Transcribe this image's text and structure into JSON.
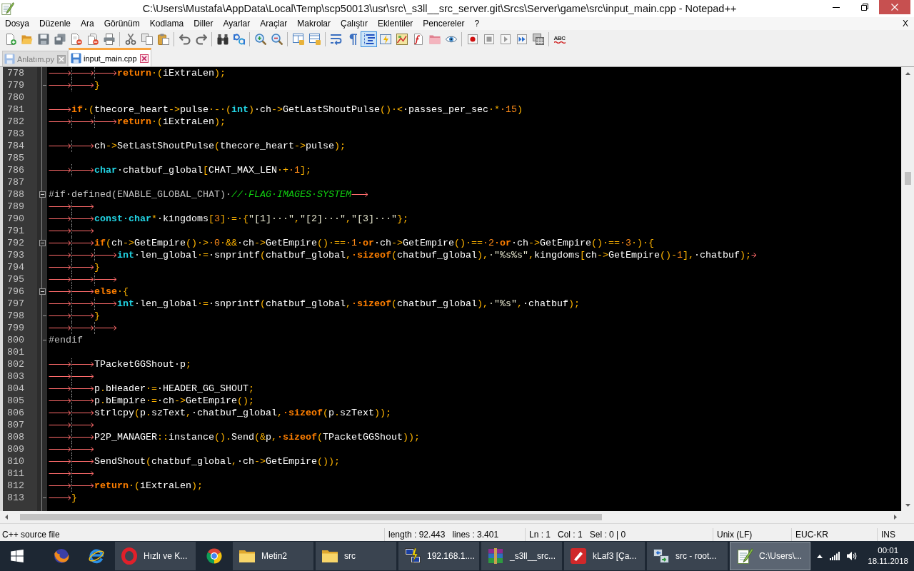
{
  "window": {
    "title": "C:\\Users\\Mustafa\\AppData\\Local\\Temp\\scp50013\\usr\\src\\_s3ll__src_server.git\\Srcs\\Server\\game\\src\\input_main.cpp - Notepad++"
  },
  "menu": {
    "items": [
      "Dosya",
      "Düzenle",
      "Ara",
      "Görünüm",
      "Kodlama",
      "Diller",
      "Ayarlar",
      "Araçlar",
      "Makrolar",
      "Çalıştır",
      "Eklentiler",
      "Pencereler",
      "?"
    ],
    "close": "X"
  },
  "toolbar": {
    "groups": [
      {
        "buttons": [
          {
            "kind": "new",
            "on": false
          },
          {
            "kind": "open",
            "on": false
          },
          {
            "kind": "save",
            "on": false
          },
          {
            "kind": "saveall",
            "on": false
          },
          {
            "kind": "close",
            "on": false
          },
          {
            "kind": "closeall",
            "on": false
          },
          {
            "kind": "print",
            "on": false
          }
        ]
      },
      {
        "buttons": [
          {
            "kind": "cut",
            "on": false
          },
          {
            "kind": "copy",
            "on": false
          },
          {
            "kind": "paste",
            "on": false
          }
        ]
      },
      {
        "buttons": [
          {
            "kind": "undo",
            "on": false
          },
          {
            "kind": "redo",
            "on": false
          }
        ]
      },
      {
        "buttons": [
          {
            "kind": "find",
            "on": false
          },
          {
            "kind": "replace",
            "on": false
          }
        ]
      },
      {
        "buttons": [
          {
            "kind": "zoomin",
            "on": false
          },
          {
            "kind": "zoomout",
            "on": false
          }
        ]
      },
      {
        "buttons": [
          {
            "kind": "syncv",
            "on": false
          },
          {
            "kind": "synch",
            "on": false
          }
        ]
      },
      {
        "buttons": [
          {
            "kind": "wrap",
            "on": false
          },
          {
            "kind": "allchars",
            "on": false
          },
          {
            "kind": "guide",
            "on": true
          },
          {
            "kind": "udl",
            "on": false
          },
          {
            "kind": "docmap",
            "on": false
          },
          {
            "kind": "funclist",
            "on": false
          },
          {
            "kind": "workspace",
            "on": false
          },
          {
            "kind": "monitor",
            "on": false
          }
        ]
      },
      {
        "buttons": [
          {
            "kind": "record",
            "on": false
          },
          {
            "kind": "stop",
            "on": false
          },
          {
            "kind": "play",
            "on": false
          },
          {
            "kind": "playmulti",
            "on": false
          },
          {
            "kind": "savemacro",
            "on": false
          }
        ]
      },
      {
        "buttons": [
          {
            "kind": "spell",
            "text": "ABC"
          }
        ]
      }
    ]
  },
  "tabs": [
    {
      "label": "Anlatım.py",
      "selected": false
    },
    {
      "label": "input_main.cpp",
      "selected": true
    }
  ],
  "editor": {
    "lines": [
      {
        "number": "778",
        "kind": "plain",
        "tokens": [
          {
            "kind": "tab"
          },
          {
            "kind": "tab"
          },
          {
            "kind": "tab"
          },
          {
            "kind": "kw",
            "text": "return"
          },
          {
            "kind": "op",
            "text": "·("
          },
          {
            "kind": "id",
            "text": "iExtraLen"
          },
          {
            "kind": "op",
            "text": ");"
          }
        ]
      },
      {
        "number": "779",
        "kind": "foldtail",
        "tokens": [
          {
            "kind": "tab"
          },
          {
            "kind": "tab"
          },
          {
            "kind": "op",
            "text": "}"
          }
        ]
      },
      {
        "number": "780",
        "kind": "plain"
      },
      {
        "number": "781",
        "kind": "plain",
        "tokens": [
          {
            "kind": "tab"
          },
          {
            "kind": "kw",
            "text": "if"
          },
          {
            "kind": "op",
            "text": "·("
          },
          {
            "kind": "id",
            "text": "thecore_heart"
          },
          {
            "kind": "op",
            "text": "->"
          },
          {
            "kind": "id",
            "text": "pulse"
          },
          {
            "kind": "op",
            "text": "·-·("
          },
          {
            "kind": "type",
            "text": "int"
          },
          {
            "kind": "op",
            "text": ")"
          },
          {
            "kind": "id",
            "text": "·ch"
          },
          {
            "kind": "op",
            "text": "->"
          },
          {
            "kind": "id",
            "text": "GetLastShoutPulse"
          },
          {
            "kind": "op",
            "text": "()·<"
          },
          {
            "kind": "id",
            "text": "·passes_per_sec"
          },
          {
            "kind": "op",
            "text": "·*"
          },
          {
            "kind": "num",
            "text": "·15"
          },
          {
            "kind": "op",
            "text": ")"
          }
        ]
      },
      {
        "number": "782",
        "kind": "plain",
        "tokens": [
          {
            "kind": "tab"
          },
          {
            "kind": "tab"
          },
          {
            "kind": "tab"
          },
          {
            "kind": "kw",
            "text": "return"
          },
          {
            "kind": "op",
            "text": "·("
          },
          {
            "kind": "id",
            "text": "iExtraLen"
          },
          {
            "kind": "op",
            "text": ");"
          }
        ]
      },
      {
        "number": "783",
        "kind": "plain"
      },
      {
        "number": "784",
        "kind": "plain",
        "tokens": [
          {
            "kind": "tab"
          },
          {
            "kind": "tab"
          },
          {
            "kind": "id",
            "text": "ch"
          },
          {
            "kind": "op",
            "text": "->"
          },
          {
            "kind": "id",
            "text": "SetLastShoutPulse"
          },
          {
            "kind": "op",
            "text": "("
          },
          {
            "kind": "id",
            "text": "thecore_heart"
          },
          {
            "kind": "op",
            "text": "->"
          },
          {
            "kind": "id",
            "text": "pulse"
          },
          {
            "kind": "op",
            "text": ");"
          }
        ]
      },
      {
        "number": "785",
        "kind": "plain"
      },
      {
        "number": "786",
        "kind": "plain",
        "tokens": [
          {
            "kind": "tab"
          },
          {
            "kind": "tab"
          },
          {
            "kind": "type",
            "text": "char"
          },
          {
            "kind": "id",
            "text": "·chatbuf_global"
          },
          {
            "kind": "op",
            "text": "["
          },
          {
            "kind": "id",
            "text": "CHAT_MAX_LEN"
          },
          {
            "kind": "op",
            "text": "·+"
          },
          {
            "kind": "num",
            "text": "·1"
          },
          {
            "kind": "op",
            "text": "];"
          }
        ]
      },
      {
        "number": "787",
        "kind": "plain"
      },
      {
        "number": "788",
        "kind": "foldhead",
        "tokens": [
          {
            "kind": "pre",
            "text": "#if·defined(ENABLE_GLOBAL_CHAT)·"
          },
          {
            "kind": "cmt",
            "text": "//·FLAG·IMAGES·SYSTEM"
          },
          {
            "kind": "tab"
          }
        ]
      },
      {
        "number": "789",
        "kind": "plain",
        "tokens": [
          {
            "kind": "tab"
          },
          {
            "kind": "tab"
          }
        ]
      },
      {
        "number": "790",
        "kind": "plain",
        "tokens": [
          {
            "kind": "tab"
          },
          {
            "kind": "tab"
          },
          {
            "kind": "type",
            "text": "const·char"
          },
          {
            "kind": "op",
            "text": "*"
          },
          {
            "kind": "id",
            "text": "·kingdoms"
          },
          {
            "kind": "op",
            "text": "["
          },
          {
            "kind": "num",
            "text": "3"
          },
          {
            "kind": "op",
            "text": "]·=·{"
          },
          {
            "kind": "str",
            "text": "\"[1]···\""
          },
          {
            "kind": "op",
            "text": ","
          },
          {
            "kind": "str",
            "text": "\"[2]···\""
          },
          {
            "kind": "op",
            "text": ","
          },
          {
            "kind": "str",
            "text": "\"[3]···\""
          },
          {
            "kind": "op",
            "text": "};"
          }
        ]
      },
      {
        "number": "791",
        "kind": "plain",
        "tokens": [
          {
            "kind": "tab"
          },
          {
            "kind": "tab"
          }
        ]
      },
      {
        "number": "792",
        "kind": "foldhead",
        "tokens": [
          {
            "kind": "tab"
          },
          {
            "kind": "tab"
          },
          {
            "kind": "kw",
            "text": "if"
          },
          {
            "kind": "op",
            "text": "("
          },
          {
            "kind": "id",
            "text": "ch"
          },
          {
            "kind": "op",
            "text": "->"
          },
          {
            "kind": "id",
            "text": "GetEmpire"
          },
          {
            "kind": "op",
            "text": "()·>"
          },
          {
            "kind": "num",
            "text": "·0"
          },
          {
            "kind": "op",
            "text": "·&&"
          },
          {
            "kind": "id",
            "text": "·ch"
          },
          {
            "kind": "op",
            "text": "->"
          },
          {
            "kind": "id",
            "text": "GetEmpire"
          },
          {
            "kind": "op",
            "text": "()·=="
          },
          {
            "kind": "num",
            "text": "·1"
          },
          {
            "kind": "kw",
            "text": "·or"
          },
          {
            "kind": "id",
            "text": "·ch"
          },
          {
            "kind": "op",
            "text": "->"
          },
          {
            "kind": "id",
            "text": "GetEmpire"
          },
          {
            "kind": "op",
            "text": "()·=="
          },
          {
            "kind": "num",
            "text": "·2"
          },
          {
            "kind": "kw",
            "text": "·or"
          },
          {
            "kind": "id",
            "text": "·ch"
          },
          {
            "kind": "op",
            "text": "->"
          },
          {
            "kind": "id",
            "text": "GetEmpire"
          },
          {
            "kind": "op",
            "text": "()·=="
          },
          {
            "kind": "num",
            "text": "·3"
          },
          {
            "kind": "op",
            "text": "·)·{"
          }
        ]
      },
      {
        "number": "793",
        "kind": "plain",
        "tokens": [
          {
            "kind": "tab"
          },
          {
            "kind": "tab"
          },
          {
            "kind": "tab"
          },
          {
            "kind": "type",
            "text": "int"
          },
          {
            "kind": "id",
            "text": "·len_global"
          },
          {
            "kind": "op",
            "text": "·="
          },
          {
            "kind": "id",
            "text": "·snprintf"
          },
          {
            "kind": "op",
            "text": "("
          },
          {
            "kind": "id",
            "text": "chatbuf_global"
          },
          {
            "kind": "op",
            "text": ","
          },
          {
            "kind": "kw",
            "text": "·sizeof"
          },
          {
            "kind": "op",
            "text": "("
          },
          {
            "kind": "id",
            "text": "chatbuf_global"
          },
          {
            "kind": "op",
            "text": "),"
          },
          {
            "kind": "str",
            "text": "·\"%s%s\""
          },
          {
            "kind": "op",
            "text": ","
          },
          {
            "kind": "id",
            "text": "kingdoms"
          },
          {
            "kind": "op",
            "text": "["
          },
          {
            "kind": "id",
            "text": "ch"
          },
          {
            "kind": "op",
            "text": "->"
          },
          {
            "kind": "id",
            "text": "GetEmpire"
          },
          {
            "kind": "op",
            "text": "()-"
          },
          {
            "kind": "num",
            "text": "1"
          },
          {
            "kind": "op",
            "text": "],"
          },
          {
            "kind": "id",
            "text": "·chatbuf"
          },
          {
            "kind": "op",
            "text": ");"
          },
          {
            "kind": "tab"
          }
        ]
      },
      {
        "number": "794",
        "kind": "plain",
        "tokens": [
          {
            "kind": "tab"
          },
          {
            "kind": "tab"
          },
          {
            "kind": "op",
            "text": "}"
          }
        ]
      },
      {
        "number": "795",
        "kind": "plain",
        "tokens": [
          {
            "kind": "tab"
          },
          {
            "kind": "tab"
          },
          {
            "kind": "tab"
          }
        ]
      },
      {
        "number": "796",
        "kind": "foldhead",
        "tokens": [
          {
            "kind": "tab"
          },
          {
            "kind": "tab"
          },
          {
            "kind": "kw",
            "text": "else"
          },
          {
            "kind": "op",
            "text": "·{"
          }
        ]
      },
      {
        "number": "797",
        "kind": "plain",
        "tokens": [
          {
            "kind": "tab"
          },
          {
            "kind": "tab"
          },
          {
            "kind": "tab"
          },
          {
            "kind": "type",
            "text": "int"
          },
          {
            "kind": "id",
            "text": "·len_global"
          },
          {
            "kind": "op",
            "text": "·="
          },
          {
            "kind": "id",
            "text": "·snprintf"
          },
          {
            "kind": "op",
            "text": "("
          },
          {
            "kind": "id",
            "text": "chatbuf_global"
          },
          {
            "kind": "op",
            "text": ","
          },
          {
            "kind": "kw",
            "text": "·sizeof"
          },
          {
            "kind": "op",
            "text": "("
          },
          {
            "kind": "id",
            "text": "chatbuf_global"
          },
          {
            "kind": "op",
            "text": "),"
          },
          {
            "kind": "str",
            "text": "·\"%s\""
          },
          {
            "kind": "op",
            "text": ","
          },
          {
            "kind": "id",
            "text": "·chatbuf"
          },
          {
            "kind": "op",
            "text": ");"
          }
        ]
      },
      {
        "number": "798",
        "kind": "foldtail",
        "tokens": [
          {
            "kind": "tab"
          },
          {
            "kind": "tab"
          },
          {
            "kind": "op",
            "text": "}"
          }
        ]
      },
      {
        "number": "799",
        "kind": "plain",
        "tokens": [
          {
            "kind": "tab"
          },
          {
            "kind": "tab"
          },
          {
            "kind": "tab"
          }
        ]
      },
      {
        "number": "800",
        "kind": "foldtail",
        "tokens": [
          {
            "kind": "pre",
            "text": "#endif"
          }
        ]
      },
      {
        "number": "801",
        "kind": "plain"
      },
      {
        "number": "802",
        "kind": "plain",
        "tokens": [
          {
            "kind": "tab"
          },
          {
            "kind": "tab"
          },
          {
            "kind": "id",
            "text": "TPacketGGShout·p"
          },
          {
            "kind": "op",
            "text": ";"
          }
        ]
      },
      {
        "number": "803",
        "kind": "plain",
        "tokens": [
          {
            "kind": "tab"
          },
          {
            "kind": "tab"
          }
        ]
      },
      {
        "number": "804",
        "kind": "plain",
        "tokens": [
          {
            "kind": "tab"
          },
          {
            "kind": "tab"
          },
          {
            "kind": "id",
            "text": "p"
          },
          {
            "kind": "op",
            "text": "."
          },
          {
            "kind": "id",
            "text": "bHeader"
          },
          {
            "kind": "op",
            "text": "·="
          },
          {
            "kind": "id",
            "text": "·HEADER_GG_SHOUT"
          },
          {
            "kind": "op",
            "text": ";"
          }
        ]
      },
      {
        "number": "805",
        "kind": "plain",
        "tokens": [
          {
            "kind": "tab"
          },
          {
            "kind": "tab"
          },
          {
            "kind": "id",
            "text": "p"
          },
          {
            "kind": "op",
            "text": "."
          },
          {
            "kind": "id",
            "text": "bEmpire"
          },
          {
            "kind": "op",
            "text": "·="
          },
          {
            "kind": "id",
            "text": "·ch"
          },
          {
            "kind": "op",
            "text": "->"
          },
          {
            "kind": "id",
            "text": "GetEmpire"
          },
          {
            "kind": "op",
            "text": "();"
          }
        ]
      },
      {
        "number": "806",
        "kind": "plain",
        "tokens": [
          {
            "kind": "tab"
          },
          {
            "kind": "tab"
          },
          {
            "kind": "id",
            "text": "strlcpy"
          },
          {
            "kind": "op",
            "text": "("
          },
          {
            "kind": "id",
            "text": "p"
          },
          {
            "kind": "op",
            "text": "."
          },
          {
            "kind": "id",
            "text": "szText"
          },
          {
            "kind": "op",
            "text": ","
          },
          {
            "kind": "id",
            "text": "·chatbuf_global"
          },
          {
            "kind": "op",
            "text": ","
          },
          {
            "kind": "kw",
            "text": "·sizeof"
          },
          {
            "kind": "op",
            "text": "("
          },
          {
            "kind": "id",
            "text": "p"
          },
          {
            "kind": "op",
            "text": "."
          },
          {
            "kind": "id",
            "text": "szText"
          },
          {
            "kind": "op",
            "text": "));"
          }
        ]
      },
      {
        "number": "807",
        "kind": "plain",
        "tokens": [
          {
            "kind": "tab"
          },
          {
            "kind": "tab"
          }
        ]
      },
      {
        "number": "808",
        "kind": "plain",
        "tokens": [
          {
            "kind": "tab"
          },
          {
            "kind": "tab"
          },
          {
            "kind": "id",
            "text": "P2P_MANAGER"
          },
          {
            "kind": "op",
            "text": "::"
          },
          {
            "kind": "id",
            "text": "instance"
          },
          {
            "kind": "op",
            "text": "()."
          },
          {
            "kind": "id",
            "text": "Send"
          },
          {
            "kind": "op",
            "text": "(&"
          },
          {
            "kind": "id",
            "text": "p"
          },
          {
            "kind": "op",
            "text": ","
          },
          {
            "kind": "kw",
            "text": "·sizeof"
          },
          {
            "kind": "op",
            "text": "("
          },
          {
            "kind": "id",
            "text": "TPacketGGShout"
          },
          {
            "kind": "op",
            "text": "));"
          }
        ]
      },
      {
        "number": "809",
        "kind": "plain",
        "tokens": [
          {
            "kind": "tab"
          },
          {
            "kind": "tab"
          }
        ]
      },
      {
        "number": "810",
        "kind": "plain",
        "tokens": [
          {
            "kind": "tab"
          },
          {
            "kind": "tab"
          },
          {
            "kind": "id",
            "text": "SendShout"
          },
          {
            "kind": "op",
            "text": "("
          },
          {
            "kind": "id",
            "text": "chatbuf_global"
          },
          {
            "kind": "op",
            "text": ","
          },
          {
            "kind": "id",
            "text": "·ch"
          },
          {
            "kind": "op",
            "text": "->"
          },
          {
            "kind": "id",
            "text": "GetEmpire"
          },
          {
            "kind": "op",
            "text": "());"
          }
        ]
      },
      {
        "number": "811",
        "kind": "plain",
        "tokens": [
          {
            "kind": "tab"
          },
          {
            "kind": "tab"
          }
        ]
      },
      {
        "number": "812",
        "kind": "plain",
        "tokens": [
          {
            "kind": "tab"
          },
          {
            "kind": "tab"
          },
          {
            "kind": "kw",
            "text": "return"
          },
          {
            "kind": "op",
            "text": "·("
          },
          {
            "kind": "id",
            "text": "iExtraLen"
          },
          {
            "kind": "op",
            "text": ");"
          }
        ]
      },
      {
        "number": "813",
        "kind": "foldtail",
        "tokens": [
          {
            "kind": "tab"
          },
          {
            "kind": "op",
            "text": "}"
          }
        ]
      }
    ]
  },
  "status_bar": {
    "file_type": "C++ source file",
    "length": "length : 92.443",
    "lines": "lines : 3.401",
    "ln": "Ln : 1",
    "col": "Col : 1",
    "sel": "Sel : 0 | 0",
    "eol": "Unix (LF)",
    "encoding": "EUC-KR",
    "mode": "INS"
  },
  "taskbar": {
    "items": [
      {
        "kind": "fox",
        "selected": false
      },
      {
        "kind": "ering",
        "selected": false
      },
      {
        "kind": "ring",
        "label": "Hızlı ve K...",
        "selected": false
      },
      {
        "kind": "segments",
        "selected": false
      },
      {
        "kind": "folder",
        "label": "Metin2",
        "selected": false
      },
      {
        "kind": "folder",
        "label": "src",
        "selected": false
      },
      {
        "kind": "terminal",
        "label": "192.168.1....",
        "selected": false
      },
      {
        "kind": "archive",
        "label": "_s3ll__src...",
        "selected": false
      },
      {
        "kind": "tile",
        "label": "kLaf3 [Ça...",
        "selected": false
      },
      {
        "kind": "transfer",
        "label": "src - root...",
        "selected": false
      },
      {
        "kind": "notepad",
        "label": "C:\\Users\\...",
        "selected": true
      }
    ],
    "tray": {
      "time": "00:01",
      "date": "18.11.2018"
    }
  }
}
